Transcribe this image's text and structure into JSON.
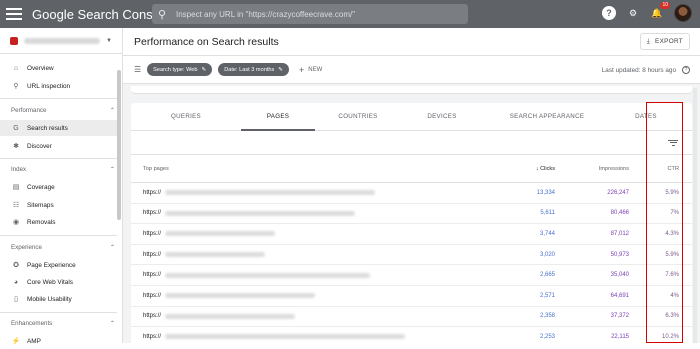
{
  "app": {
    "logo": "Google Search Console",
    "search_placeholder": "Inspect any URL in \"https://crazycoffeecrave.com/\"",
    "notifications_count": "10"
  },
  "sidebar": {
    "items_top": [
      {
        "label": "Overview",
        "icon": "home-icon"
      },
      {
        "label": "URL inspection",
        "icon": "search-icon"
      }
    ],
    "sections": [
      {
        "title": "Performance",
        "items": [
          {
            "label": "Search results",
            "icon": "google-g-icon",
            "active": true
          },
          {
            "label": "Discover",
            "icon": "asterisk-icon"
          }
        ]
      },
      {
        "title": "Index",
        "items": [
          {
            "label": "Coverage",
            "icon": "file-icon"
          },
          {
            "label": "Sitemaps",
            "icon": "sitemap-icon"
          },
          {
            "label": "Removals",
            "icon": "eye-off-icon"
          }
        ]
      },
      {
        "title": "Experience",
        "items": [
          {
            "label": "Page Experience",
            "icon": "star-circle-icon"
          },
          {
            "label": "Core Web Vitals",
            "icon": "gauge-icon"
          },
          {
            "label": "Mobile Usability",
            "icon": "phone-icon"
          }
        ]
      },
      {
        "title": "Enhancements",
        "items": [
          {
            "label": "AMP",
            "icon": "bolt-icon"
          }
        ]
      }
    ]
  },
  "header": {
    "title": "Performance on Search results",
    "export_label": "EXPORT"
  },
  "filters": {
    "chips": [
      "Search type: Web",
      "Date: Last 3 months"
    ],
    "new_label": "NEW",
    "updated": "Last updated: 8 hours ago"
  },
  "tabs": [
    "QUERIES",
    "PAGES",
    "COUNTRIES",
    "DEVICES",
    "SEARCH APPEARANCE",
    "DATES"
  ],
  "table": {
    "headers": {
      "page": "Top pages",
      "clicks": "Clicks",
      "impressions": "Impressions",
      "ctr": "CTR"
    },
    "rows": [
      {
        "page": "https://",
        "clicks": "13,334",
        "impressions": "226,247",
        "ctr": "5.9%"
      },
      {
        "page": "https://",
        "clicks": "5,611",
        "impressions": "80,466",
        "ctr": "7%"
      },
      {
        "page": "https://",
        "clicks": "3,744",
        "impressions": "87,012",
        "ctr": "4.3%"
      },
      {
        "page": "https://",
        "clicks": "3,020",
        "impressions": "50,973",
        "ctr": "5.9%"
      },
      {
        "page": "https://",
        "clicks": "2,665",
        "impressions": "35,040",
        "ctr": "7.6%"
      },
      {
        "page": "https://",
        "clicks": "2,571",
        "impressions": "64,691",
        "ctr": "4%"
      },
      {
        "page": "https://",
        "clicks": "2,358",
        "impressions": "37,372",
        "ctr": "6.3%"
      },
      {
        "page": "https://",
        "clicks": "2,253",
        "impressions": "22,115",
        "ctr": "10.2%"
      }
    ]
  },
  "colors": {
    "topbar": "#5f6368",
    "highlight": "#d50000",
    "clicks": "#4a6fd0",
    "impressions": "#7b3fb5"
  }
}
